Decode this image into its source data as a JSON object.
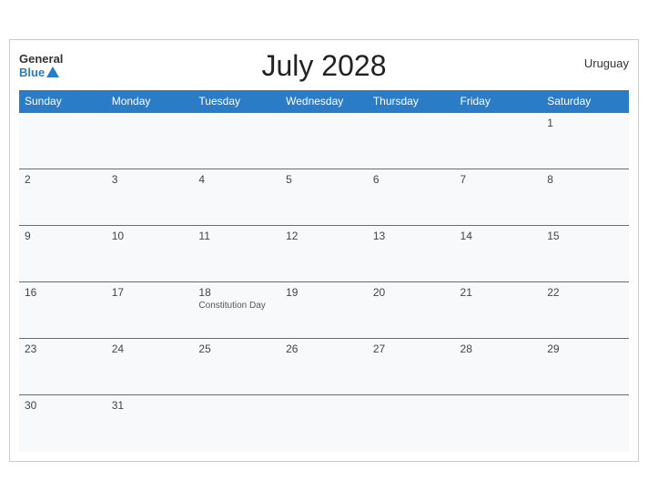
{
  "header": {
    "title": "July 2028",
    "country": "Uruguay",
    "logo_general": "General",
    "logo_blue": "Blue"
  },
  "weekdays": [
    "Sunday",
    "Monday",
    "Tuesday",
    "Wednesday",
    "Thursday",
    "Friday",
    "Saturday"
  ],
  "weeks": [
    [
      {
        "day": "",
        "empty": true
      },
      {
        "day": "",
        "empty": true
      },
      {
        "day": "",
        "empty": true
      },
      {
        "day": "",
        "empty": true
      },
      {
        "day": "",
        "empty": true
      },
      {
        "day": "",
        "empty": true
      },
      {
        "day": "1",
        "holiday": ""
      }
    ],
    [
      {
        "day": "2",
        "holiday": ""
      },
      {
        "day": "3",
        "holiday": ""
      },
      {
        "day": "4",
        "holiday": ""
      },
      {
        "day": "5",
        "holiday": ""
      },
      {
        "day": "6",
        "holiday": ""
      },
      {
        "day": "7",
        "holiday": ""
      },
      {
        "day": "8",
        "holiday": ""
      }
    ],
    [
      {
        "day": "9",
        "holiday": ""
      },
      {
        "day": "10",
        "holiday": ""
      },
      {
        "day": "11",
        "holiday": ""
      },
      {
        "day": "12",
        "holiday": ""
      },
      {
        "day": "13",
        "holiday": ""
      },
      {
        "day": "14",
        "holiday": ""
      },
      {
        "day": "15",
        "holiday": ""
      }
    ],
    [
      {
        "day": "16",
        "holiday": ""
      },
      {
        "day": "17",
        "holiday": ""
      },
      {
        "day": "18",
        "holiday": "Constitution Day"
      },
      {
        "day": "19",
        "holiday": ""
      },
      {
        "day": "20",
        "holiday": ""
      },
      {
        "day": "21",
        "holiday": ""
      },
      {
        "day": "22",
        "holiday": ""
      }
    ],
    [
      {
        "day": "23",
        "holiday": ""
      },
      {
        "day": "24",
        "holiday": ""
      },
      {
        "day": "25",
        "holiday": ""
      },
      {
        "day": "26",
        "holiday": ""
      },
      {
        "day": "27",
        "holiday": ""
      },
      {
        "day": "28",
        "holiday": ""
      },
      {
        "day": "29",
        "holiday": ""
      }
    ],
    [
      {
        "day": "30",
        "holiday": ""
      },
      {
        "day": "31",
        "holiday": ""
      },
      {
        "day": "",
        "empty": true
      },
      {
        "day": "",
        "empty": true
      },
      {
        "day": "",
        "empty": true
      },
      {
        "day": "",
        "empty": true
      },
      {
        "day": "",
        "empty": true
      }
    ]
  ]
}
